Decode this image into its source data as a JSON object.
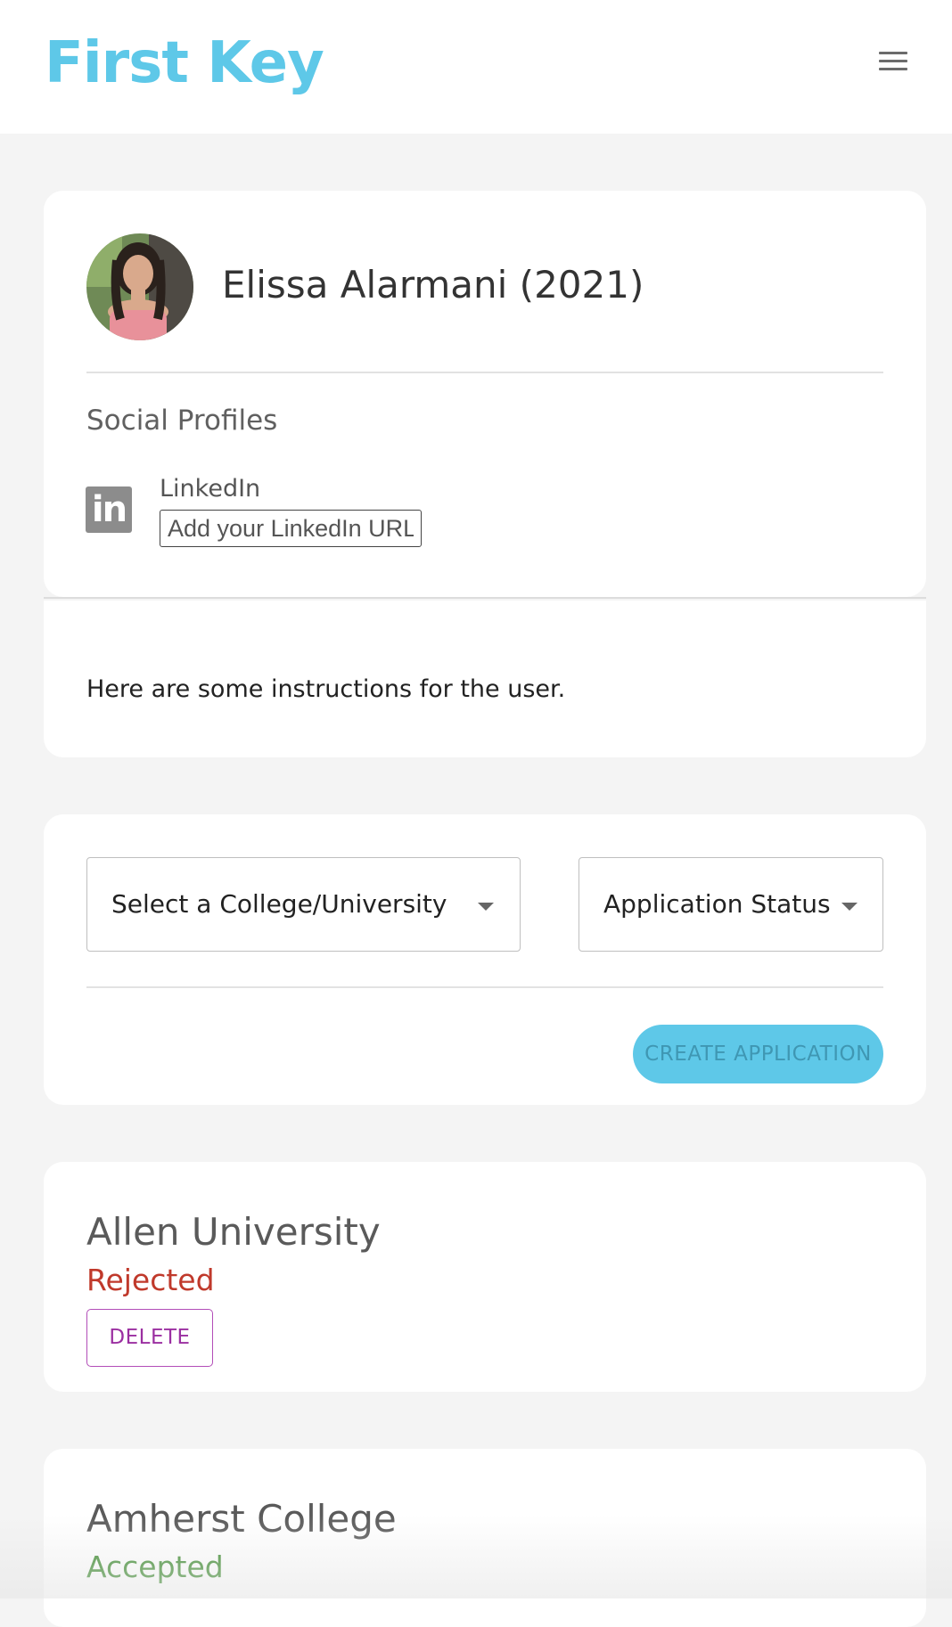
{
  "header": {
    "logo_text": "First Key",
    "menu_icon": "hamburger-menu-icon"
  },
  "profile": {
    "name": "Elissa Alarmani (2021)",
    "avatar_icon": "user-avatar-photo",
    "social_title": "Social Profiles",
    "linkedin": {
      "icon": "linkedin-icon",
      "icon_text": "in",
      "label": "LinkedIn",
      "placeholder": "Add your LinkedIn URL",
      "value": ""
    }
  },
  "instructions": {
    "text": "Here are some instructions for the user."
  },
  "create_form": {
    "college_select_label": "Select a College/University",
    "status_select_label": "Application Status",
    "create_button_label": "CREATE APPLICATION",
    "accent_color": "#5ec8e8"
  },
  "applications": [
    {
      "college": "Allen University",
      "status": "Rejected",
      "status_color": "#c0392b",
      "delete_label": "DELETE"
    },
    {
      "college": "Amherst College",
      "status": "Accepted",
      "status_color": "#3c8a2e"
    }
  ]
}
